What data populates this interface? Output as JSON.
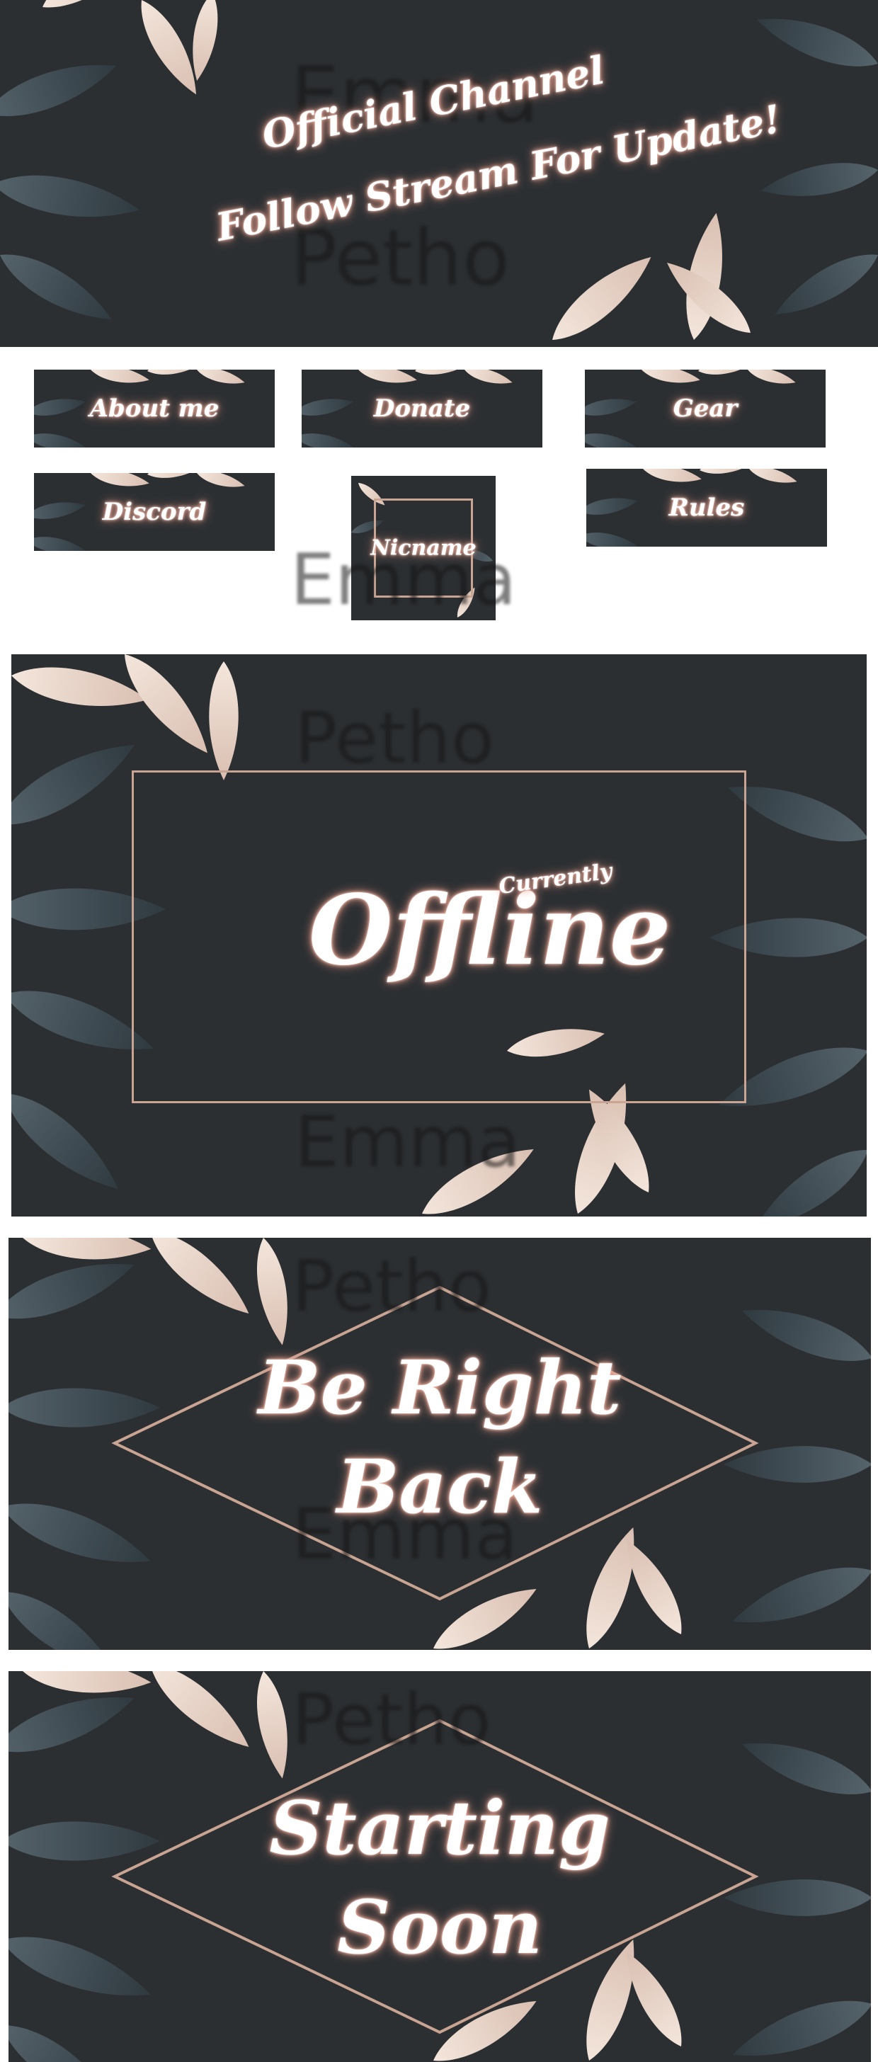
{
  "banner": {
    "line1": "Official Channel",
    "line2": "Follow Stream For Update!"
  },
  "watermark": {
    "first": "Emma",
    "last": "Petho"
  },
  "panels": {
    "about": "About me",
    "donate": "Donate",
    "gear": "Gear",
    "discord": "Discord",
    "nickname": "Nicname",
    "rules": "Rules"
  },
  "offline": {
    "small": "Currently",
    "main": "Offline"
  },
  "brb": {
    "line1": "Be Right",
    "line2": "Back"
  },
  "starting": {
    "line1": "Starting",
    "line2": "Soon"
  },
  "colors": {
    "background": "#2b2e31",
    "leaf_dark": "#3e4a52",
    "leaf_light": "#ead8cc",
    "frame": "#c9a493",
    "glow": "#e89a86"
  }
}
